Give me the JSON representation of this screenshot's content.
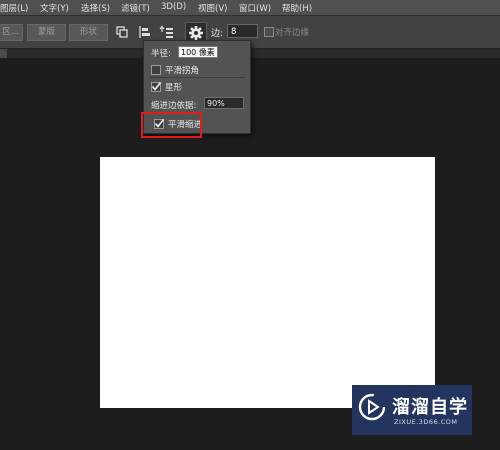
{
  "menubar": {
    "items": [
      "图层(L)",
      "文字(Y)",
      "选择(S)",
      "滤镜(T)",
      "3D(D)",
      "视图(V)",
      "窗口(W)",
      "帮助(H)"
    ]
  },
  "options_bar": {
    "btn_partial": "区...",
    "mask_label": "蒙版",
    "shape_label": "形状",
    "edge_label": "边:",
    "edge_value": "8",
    "align_edges_label": "对齐边缘"
  },
  "popup": {
    "radius_label": "半径:",
    "radius_value": "100 像素",
    "smooth_corners_label": "平滑拐角",
    "smooth_corners_checked": false,
    "star_label": "星形",
    "star_checked": true,
    "indent_label": "缩进边依据:",
    "indent_value": "90%",
    "smooth_indent_label": "平滑缩进",
    "smooth_indent_checked": true
  },
  "watermark": {
    "title": "溜溜自学",
    "url": "ZIXUE.3D66.COM"
  },
  "colors": {
    "highlight": "#e01d1d",
    "workspace": "#1d1d1d",
    "canvas": "#ffffff",
    "watermark_bg": "#23355e"
  }
}
